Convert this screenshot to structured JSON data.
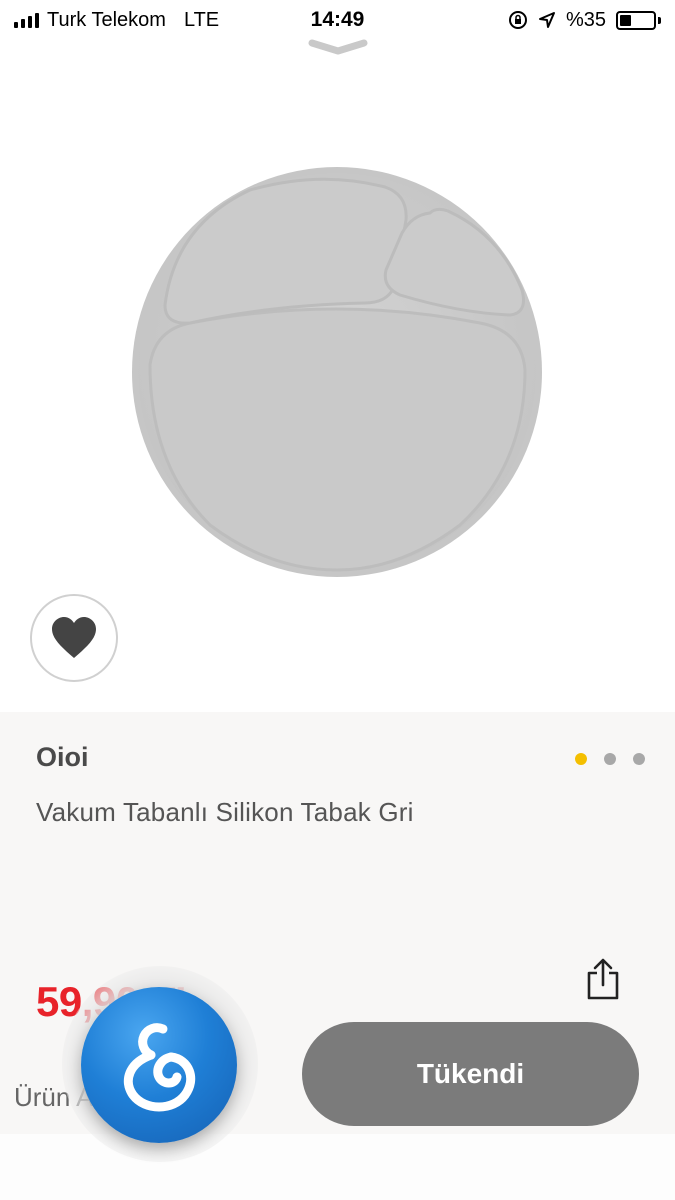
{
  "status_bar": {
    "carrier": "Turk Telekom",
    "network": "LTE",
    "time": "14:49",
    "battery_text": "%35",
    "battery_level": 0.35,
    "icons": [
      "signal-icon",
      "orientation-lock-icon",
      "location-arrow-icon",
      "battery-icon"
    ]
  },
  "sheet": {
    "handle_icon": "chevron-down-icon"
  },
  "product": {
    "image_icon": "divided-plate-image",
    "brand": "Oioi",
    "name": "Vakum Tabanlı Silikon Tabak Gri",
    "price": "59,90 TL",
    "image_count": 3,
    "active_image_index": 0,
    "favorite_icon": "heart-icon",
    "share_icon": "share-icon"
  },
  "actions": {
    "sold_out_label": "Tükendi",
    "footer_text": "Ürün Açıklaması"
  },
  "floating_button": {
    "icon": "mother-baby-logo-icon"
  },
  "colors": {
    "price": "#e8232a",
    "active_dot": "#f4bf00",
    "inactive_dot": "#a8a8a8",
    "sold_out_button": "#7b7b7b",
    "fab": "#1f7fd6"
  }
}
